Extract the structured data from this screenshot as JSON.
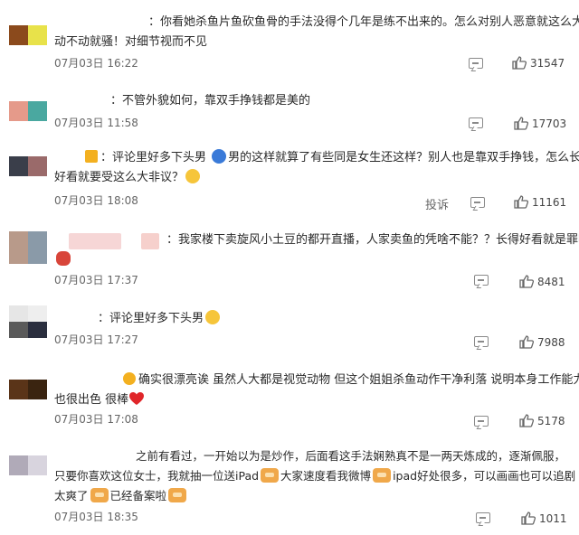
{
  "comments": [
    {
      "lines": [
        "：你看她杀鱼片鱼砍鱼骨的手法没得个几年是练不出来的。怎么对别人恶意就这么大?",
        "动不动就骚！对细节视而不见"
      ],
      "date": "07月03日 16:22",
      "likes": "31547",
      "avatar_colors": [
        "#8b4a1c",
        "#e8e24a"
      ]
    },
    {
      "lines": [
        "：不管外貌如何，靠双手挣钱都是美的"
      ],
      "date": "07月03日 11:58",
      "likes": "17703",
      "avatar_colors": [
        "#e59a8a",
        "#4aa8a0"
      ]
    },
    {
      "line1_a": "：评论里好多下头男",
      "line1_b": "男的这样就算了有些同是女生还这样？别人也是靠双手挣钱，怎么长得",
      "line2": "好看就要受这么大非议？",
      "date": "07月03日 18:08",
      "report": "投诉",
      "likes": "11161",
      "avatar_colors": [
        "#3a3e4a",
        "#9a6a6a"
      ]
    },
    {
      "line1": "：我家楼下卖旋风小土豆的都开直播，人家卖鱼的凭啥不能？？长得好看就是罪呗",
      "date": "07月03日 17:37",
      "likes": "8481",
      "avatar_colors": [
        "#b89a8a",
        "#8a9aa8"
      ]
    },
    {
      "line1": "：评论里好多下头男",
      "date": "07月03日 17:27",
      "likes": "7988",
      "avatar_colors": [
        "#5a5a5a",
        "#2a2e3e"
      ]
    },
    {
      "line1": "确实很漂亮诶 虽然人大都是视觉动物 但这个姐姐杀鱼动作干净利落 说明本身工作能力",
      "line2": "也很出色 很棒",
      "date": "07月03日 17:08",
      "likes": "5178",
      "avatar_colors": [
        "#5a3418",
        "#3a2410"
      ]
    },
    {
      "line1": "之前有看过，一开始以为是炒作，后面看这手法娴熟真不是一两天炼成的，逐渐佩服，",
      "line2_a": "只要你喜欢这位女士，我就抽一位送iPad",
      "line2_b": "大家速度看我微博",
      "line2_c": "ipad好处很多，可以画画也可以追剧",
      "line3_a": "太爽了",
      "line3_b": "已经备案啦",
      "date": "07月03日 18:35",
      "likes": "1011",
      "avatar_colors": [
        "#b0aab8",
        "#d8d4de"
      ]
    }
  ]
}
